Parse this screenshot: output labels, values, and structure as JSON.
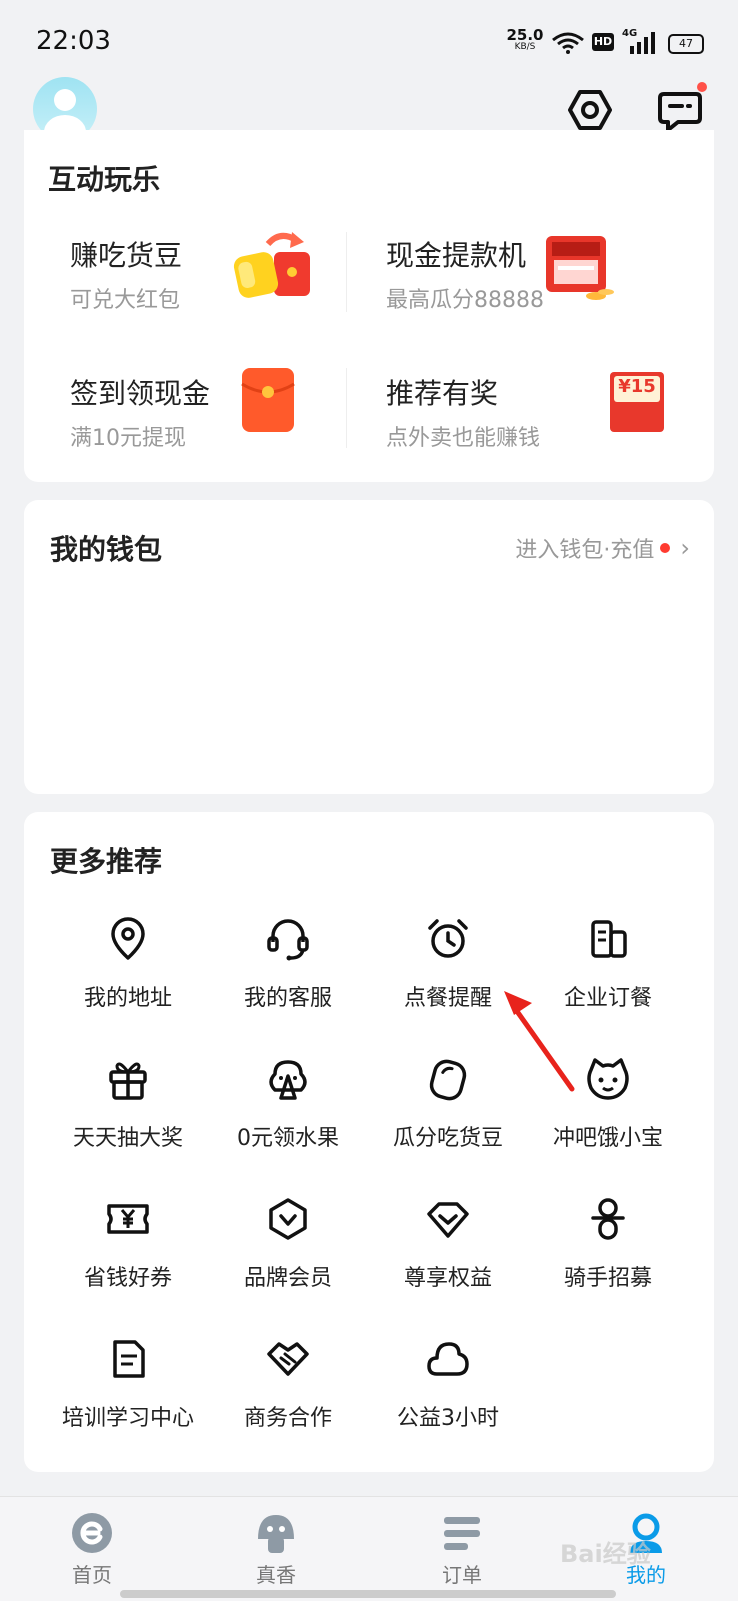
{
  "status_bar": {
    "time": "22:03",
    "net_speed_value": "25.0",
    "net_speed_unit": "KB/S",
    "hd": "HD",
    "signal_label": "4G",
    "battery": "47"
  },
  "fun_section": {
    "title": "互动玩乐",
    "items": [
      {
        "name": "赚吃货豆",
        "sub": "可兑大红包"
      },
      {
        "name": "现金提款机",
        "sub": "最高瓜分88888"
      },
      {
        "name": "签到领现金",
        "sub": "满10元提现"
      },
      {
        "name": "推荐有奖",
        "sub": "点外卖也能赚钱",
        "badge": "¥15"
      }
    ]
  },
  "wallet": {
    "title": "我的钱包",
    "link": "进入钱包·充值"
  },
  "more": {
    "title": "更多推荐",
    "items": [
      {
        "label": "我的地址",
        "icon": "location-pin-icon"
      },
      {
        "label": "我的客服",
        "icon": "headset-icon"
      },
      {
        "label": "点餐提醒",
        "icon": "alarm-clock-icon"
      },
      {
        "label": "企业订餐",
        "icon": "building-icon"
      },
      {
        "label": "天天抽大奖",
        "icon": "gift-icon"
      },
      {
        "label": "0元领水果",
        "icon": "tree-icon"
      },
      {
        "label": "瓜分吃货豆",
        "icon": "bean-icon"
      },
      {
        "label": "冲吧饿小宝",
        "icon": "cat-face-icon"
      },
      {
        "label": "省钱好券",
        "icon": "yen-coupon-icon"
      },
      {
        "label": "品牌会员",
        "icon": "hexagon-v-icon"
      },
      {
        "label": "尊享权益",
        "icon": "diamond-chevron-icon"
      },
      {
        "label": "骑手招募",
        "icon": "rider-icon"
      },
      {
        "label": "培训学习中心",
        "icon": "document-icon"
      },
      {
        "label": "商务合作",
        "icon": "handshake-icon"
      },
      {
        "label": "公益3小时",
        "icon": "cloud-icon"
      }
    ]
  },
  "tabbar": {
    "tabs": [
      {
        "label": "首页"
      },
      {
        "label": "真香"
      },
      {
        "label": "订单"
      },
      {
        "label": "我的"
      }
    ],
    "active": "我的"
  },
  "watermark": "Bai经验",
  "colors": {
    "accent": "#0a9be8",
    "red_dot": "#ff3b30",
    "background": "#f1f2f4"
  }
}
